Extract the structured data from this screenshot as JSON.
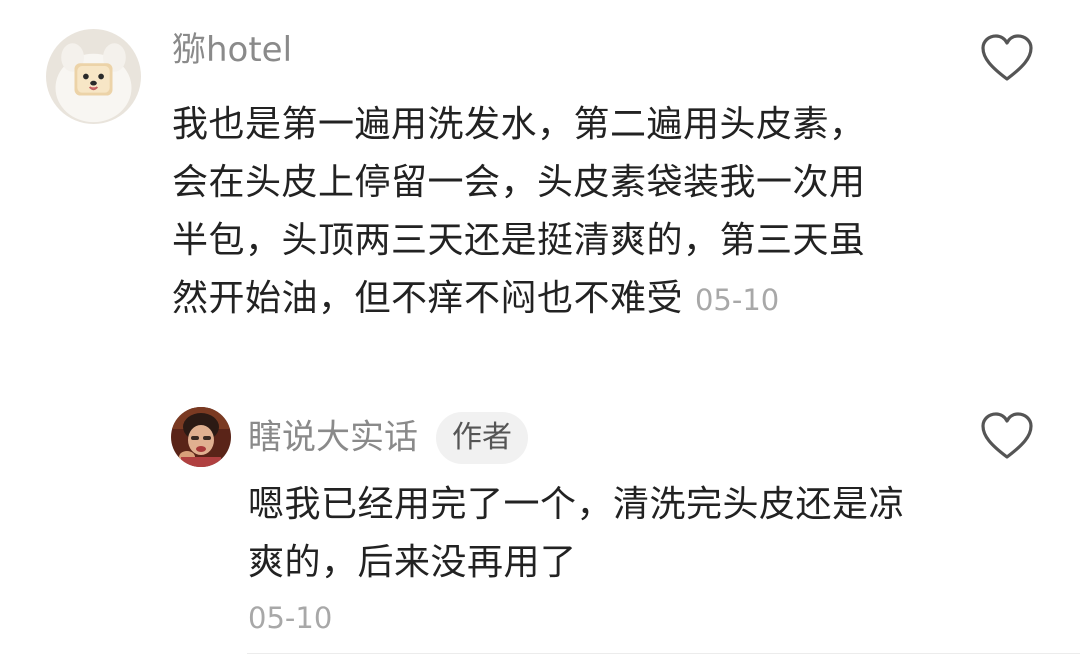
{
  "comments": [
    {
      "username": "猕hotel",
      "avatar_icon": "dog-avatar",
      "text": "我也是第一遍用洗发水，第二遍用头皮素，会在头皮上停留一会，头皮素袋装我一次用半包，头顶两三天还是挺清爽的，第三天虽然开始油，但不痒不闷也不难受",
      "date": "05-10",
      "like_icon": "heart-outline-icon"
    }
  ],
  "replies": [
    {
      "username": "瞎说大实话",
      "avatar_icon": "person-eating-avatar",
      "badge": "作者",
      "text": "嗯我已经用完了一个，清洗完头皮还是凉爽的，后来没再用了",
      "date": "05-10",
      "like_icon": "heart-outline-icon"
    }
  ],
  "colors": {
    "username": "#8a8a8a",
    "text": "#222222",
    "timestamp": "#a8a8a8",
    "badge_bg": "#f1f1f1"
  }
}
